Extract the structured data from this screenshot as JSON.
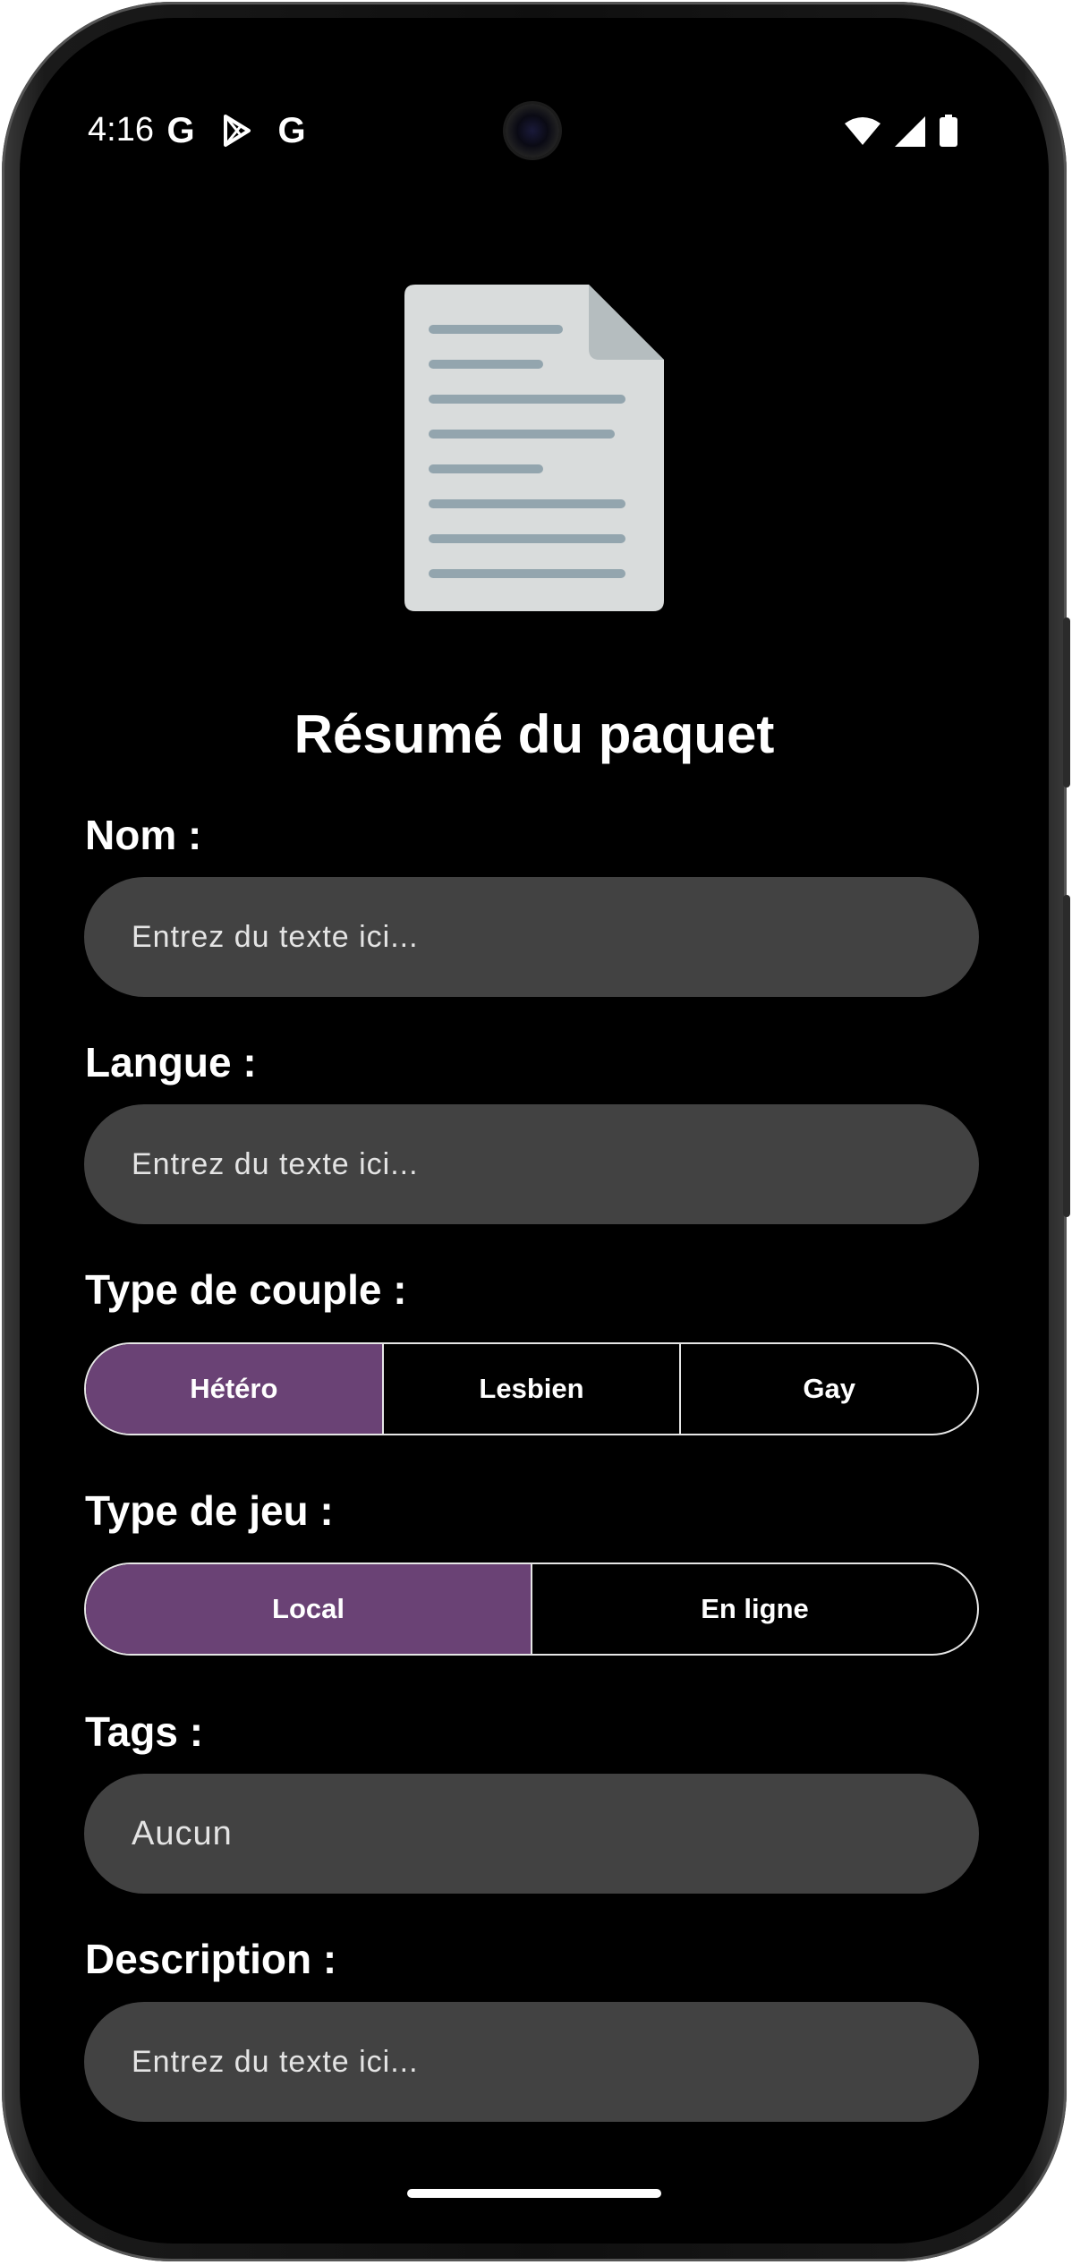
{
  "status_bar": {
    "time": "4:16",
    "left_icons": [
      "google-g-icon",
      "play-store-icon",
      "google-g-icon"
    ],
    "right_icons": [
      "wifi-icon",
      "signal-icon",
      "battery-icon"
    ]
  },
  "header": {
    "icon": "document-icon",
    "title": "Résumé du paquet"
  },
  "form": {
    "name": {
      "label": "Nom :",
      "placeholder": "Entrez du texte ici..."
    },
    "language": {
      "label": "Langue :",
      "placeholder": "Entrez du texte ici..."
    },
    "couple_type": {
      "label": "Type de couple :",
      "options": [
        "Hétéro",
        "Lesbien",
        "Gay"
      ],
      "selected": "Hétéro"
    },
    "game_type": {
      "label": "Type de jeu :",
      "options": [
        "Local",
        "En ligne"
      ],
      "selected": "Local"
    },
    "tags": {
      "label": "Tags :",
      "value": "Aucun"
    },
    "description": {
      "label": "Description :",
      "placeholder": "Entrez du texte ici..."
    }
  },
  "colors": {
    "background": "#000000",
    "field": "#424242",
    "accent": "#6a4275",
    "text": "#ffffff"
  }
}
